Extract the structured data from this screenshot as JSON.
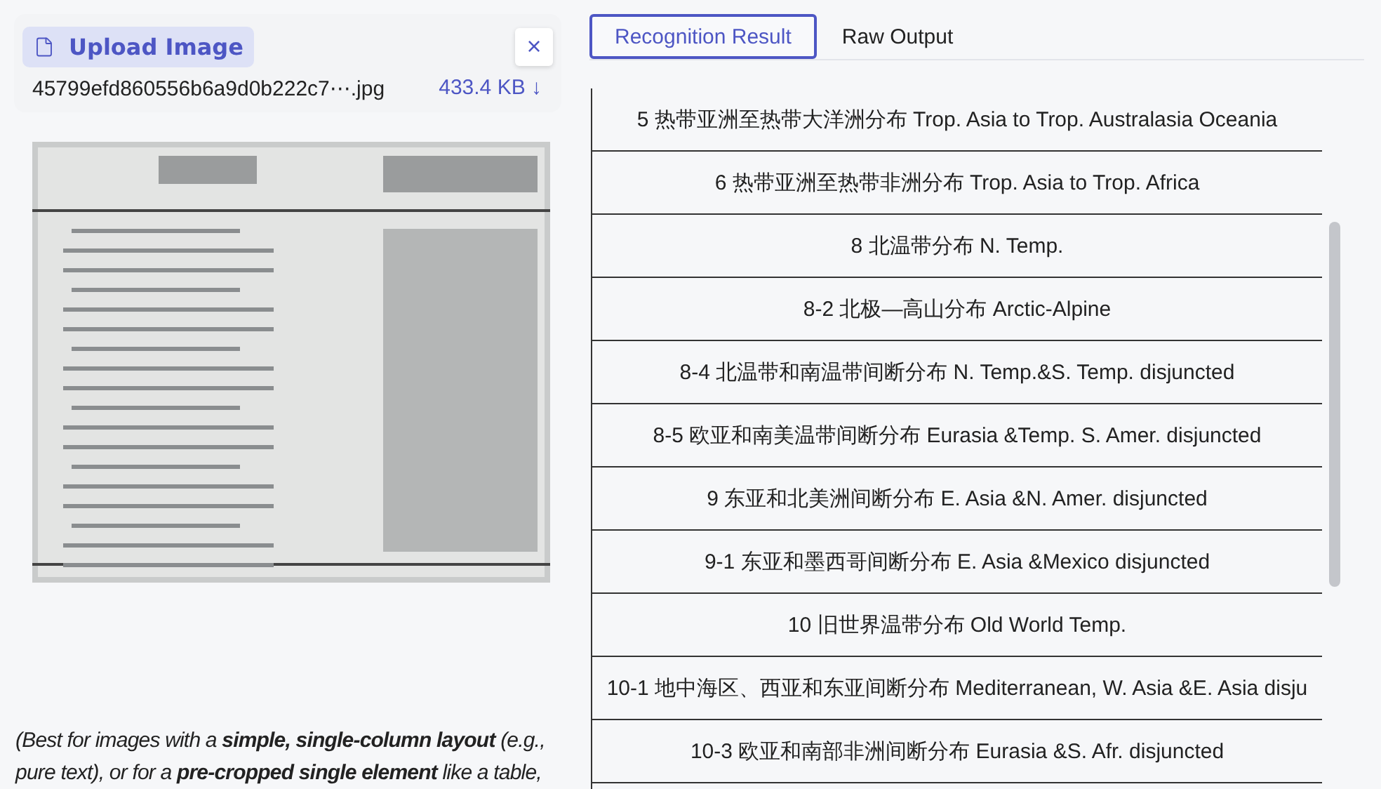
{
  "upload": {
    "button": "Upload Image",
    "close": "×",
    "file_name": "45799efd860556b6a9d0b222c7⋯.jpg",
    "file_size": "433.4 KB ↓",
    "note": "(Best for images with a **simple, single-column layout** (e.g., pure text), or for a **pre-cropped single element** like a table,"
  },
  "tabs": [
    {
      "label": "Recognition Result",
      "selected": true
    },
    {
      "label": "Raw Output",
      "selected": false
    }
  ],
  "result_rows": [
    {
      "text": "5 热带亚洲至热带大洋洲分布 Trop. Asia to Trop. Australasia Oceania"
    },
    {
      "text": "6 热带亚洲至热带非洲分布 Trop. Asia to Trop. Africa"
    },
    {
      "text": "8 北温带分布 N. Temp."
    },
    {
      "text": "8-2 北极—高山分布 Arctic-Alpine"
    },
    {
      "text": "8-4 北温带和南温带间断分布 N. Temp.&S. Temp. disjuncted"
    },
    {
      "text": "8-5 欧亚和南美温带间断分布 Eurasia &Temp. S. Amer. disjuncted"
    },
    {
      "text": "9 东亚和北美洲间断分布 E. Asia &N. Amer. disjuncted"
    },
    {
      "text": "9-1 东亚和墨西哥间断分布 E. Asia &Mexico disjuncted"
    },
    {
      "text": "10 旧世界温带分布 Old World Temp."
    },
    {
      "text": "10-1 地中海区、西亚和东亚间断分布 Mediterranean, W. Asia &E. Asia disju"
    },
    {
      "text": "10-3 欧亚和南部非洲间断分布 Eurasia &S. Afr. disjuncted"
    }
  ]
}
